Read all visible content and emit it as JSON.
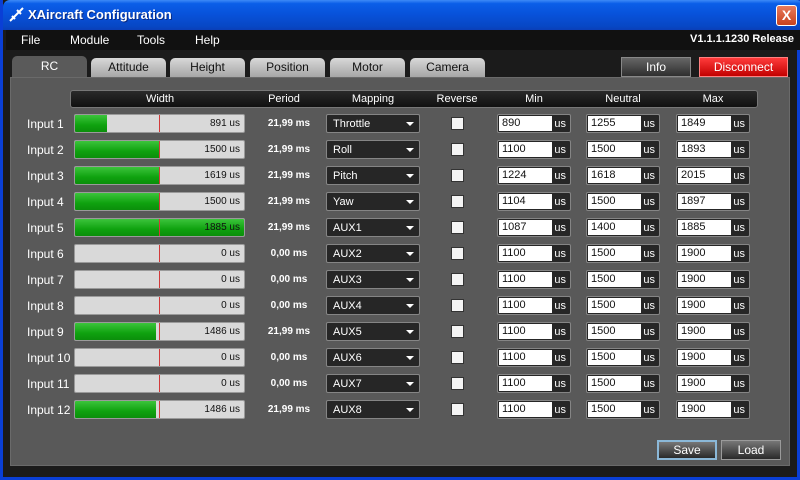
{
  "window": {
    "title": "XAircraft Configuration",
    "close_label": "X"
  },
  "menu": {
    "items": [
      "File",
      "Module",
      "Tools",
      "Help"
    ],
    "version": "V1.1.1.1230 Release"
  },
  "tabs": [
    {
      "label": "RC",
      "active": true
    },
    {
      "label": "Attitude",
      "active": false
    },
    {
      "label": "Height",
      "active": false
    },
    {
      "label": "Position",
      "active": false
    },
    {
      "label": "Motor",
      "active": false
    },
    {
      "label": "Camera",
      "active": false
    }
  ],
  "top_buttons": {
    "info": "Info",
    "disconnect": "Disconnect"
  },
  "columns": {
    "width": "Width",
    "period": "Period",
    "mapping": "Mapping",
    "reverse": "Reverse",
    "min": "Min",
    "neutral": "Neutral",
    "max": "Max"
  },
  "unit": "us",
  "inputs": [
    {
      "label": "Input 1",
      "width": "891 us",
      "fill": 0.19,
      "period": "21,99 ms",
      "mapping": "Throttle",
      "reverse": false,
      "min": "890",
      "neutral": "1255",
      "max": "1849"
    },
    {
      "label": "Input 2",
      "width": "1500 us",
      "fill": 0.5,
      "period": "21,99 ms",
      "mapping": "Roll",
      "reverse": false,
      "min": "1100",
      "neutral": "1500",
      "max": "1893"
    },
    {
      "label": "Input 3",
      "width": "1619 us",
      "fill": 0.5,
      "period": "21,99 ms",
      "mapping": "Pitch",
      "reverse": false,
      "min": "1224",
      "neutral": "1618",
      "max": "2015"
    },
    {
      "label": "Input 4",
      "width": "1500 us",
      "fill": 0.5,
      "period": "21,99 ms",
      "mapping": "Yaw",
      "reverse": false,
      "min": "1104",
      "neutral": "1500",
      "max": "1897"
    },
    {
      "label": "Input 5",
      "width": "1885 us",
      "fill": 1.0,
      "period": "21,99 ms",
      "mapping": "AUX1",
      "reverse": false,
      "min": "1087",
      "neutral": "1400",
      "max": "1885"
    },
    {
      "label": "Input 6",
      "width": "0 us",
      "fill": 0.0,
      "period": "0,00 ms",
      "mapping": "AUX2",
      "reverse": false,
      "min": "1100",
      "neutral": "1500",
      "max": "1900"
    },
    {
      "label": "Input 7",
      "width": "0 us",
      "fill": 0.0,
      "period": "0,00 ms",
      "mapping": "AUX3",
      "reverse": false,
      "min": "1100",
      "neutral": "1500",
      "max": "1900"
    },
    {
      "label": "Input 8",
      "width": "0 us",
      "fill": 0.0,
      "period": "0,00 ms",
      "mapping": "AUX4",
      "reverse": false,
      "min": "1100",
      "neutral": "1500",
      "max": "1900"
    },
    {
      "label": "Input 9",
      "width": "1486 us",
      "fill": 0.48,
      "period": "21,99 ms",
      "mapping": "AUX5",
      "reverse": false,
      "min": "1100",
      "neutral": "1500",
      "max": "1900"
    },
    {
      "label": "Input 10",
      "width": "0 us",
      "fill": 0.0,
      "period": "0,00 ms",
      "mapping": "AUX6",
      "reverse": false,
      "min": "1100",
      "neutral": "1500",
      "max": "1900"
    },
    {
      "label": "Input 11",
      "width": "0 us",
      "fill": 0.0,
      "period": "0,00 ms",
      "mapping": "AUX7",
      "reverse": false,
      "min": "1100",
      "neutral": "1500",
      "max": "1900"
    },
    {
      "label": "Input 12",
      "width": "1486 us",
      "fill": 0.48,
      "period": "21,99 ms",
      "mapping": "AUX8",
      "reverse": false,
      "min": "1100",
      "neutral": "1500",
      "max": "1900"
    }
  ],
  "bottom_buttons": {
    "save": "Save",
    "load": "Load"
  },
  "icons": {
    "app": "aircraft-icon",
    "close": "close-icon",
    "dropdown": "chevron-down-icon"
  },
  "colors": {
    "titlebar": "#0851d9",
    "panel": "#595959",
    "fill": "#0fa20f",
    "disconnect": "#c20000",
    "marker": "#d23a3a"
  }
}
